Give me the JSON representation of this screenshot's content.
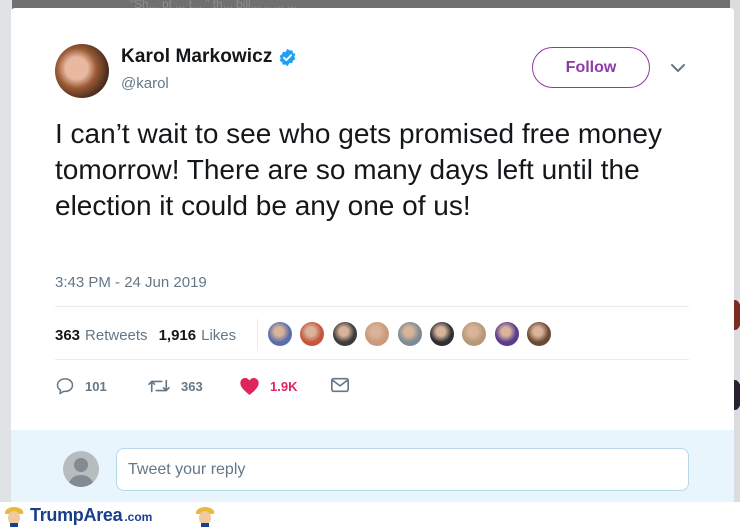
{
  "background_text": "“Sh... pt ... t... ” th... bill... .. ... ...",
  "tweet": {
    "display_name": "Karol Markowicz",
    "handle": "@karol",
    "follow_label": "Follow",
    "text": "I can’t wait to see who gets promised free money tomorrow! There are so many days left until the election it could be any one of us!",
    "timestamp": "3:43 PM - 24 Jun 2019"
  },
  "stats": {
    "retweets_count": "363",
    "retweets_label": "Retweets",
    "likes_count": "1,916",
    "likes_label": "Likes"
  },
  "liker_colors": [
    "#5b6ea8",
    "#c5563b",
    "#3c3c3c",
    "#c99a7c",
    "#7f8a93",
    "#2f2f35",
    "#b59a7a",
    "#5a3b8c",
    "#6b4a33"
  ],
  "actions": {
    "reply_count": "101",
    "retweet_count": "363",
    "like_count": "1.9K"
  },
  "reply": {
    "placeholder": "Tweet your reply"
  },
  "footer": {
    "brand": "TrumpArea",
    "tld": ".com"
  },
  "colors": {
    "follow_accent": "#8e3aa8",
    "like_heart": "#e0245e",
    "verified": "#1da1f2",
    "text_primary": "#14171a",
    "text_secondary": "#657786"
  }
}
